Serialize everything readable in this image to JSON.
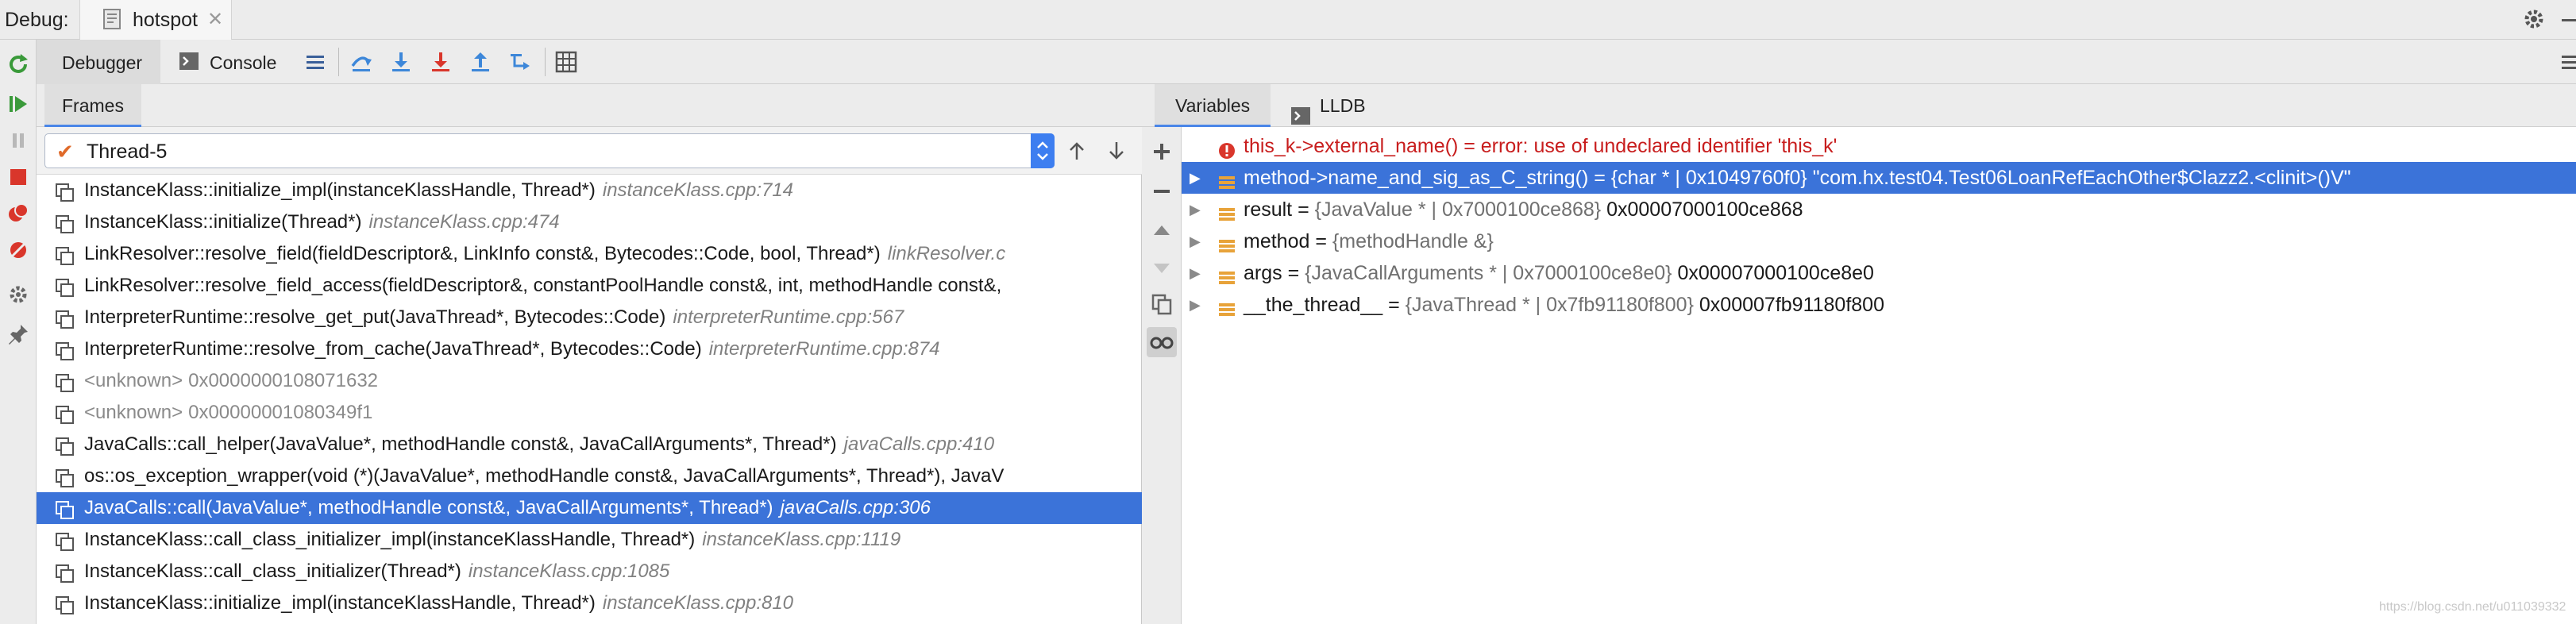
{
  "window": {
    "debug_label": "Debug:",
    "session_tab": "hotspot"
  },
  "toolbar": {
    "tabs": [
      {
        "label": "Debugger",
        "selected": true
      },
      {
        "label": "Console",
        "selected": false
      }
    ]
  },
  "frames": {
    "tab_label": "Frames",
    "thread": "Thread-5",
    "rows": [
      {
        "name": "InstanceKlass::initialize_impl(instanceKlassHandle, Thread*)",
        "loc": "instanceKlass.cpp:714",
        "unknown": false,
        "selected": false
      },
      {
        "name": "InstanceKlass::initialize(Thread*)",
        "loc": "instanceKlass.cpp:474",
        "unknown": false,
        "selected": false
      },
      {
        "name": "LinkResolver::resolve_field(fieldDescriptor&, LinkInfo const&, Bytecodes::Code, bool, Thread*)",
        "loc": "linkResolver.c",
        "unknown": false,
        "selected": false
      },
      {
        "name": "LinkResolver::resolve_field_access(fieldDescriptor&, constantPoolHandle const&, int, methodHandle const&,",
        "loc": "",
        "unknown": false,
        "selected": false
      },
      {
        "name": "InterpreterRuntime::resolve_get_put(JavaThread*, Bytecodes::Code)",
        "loc": "interpreterRuntime.cpp:567",
        "unknown": false,
        "selected": false
      },
      {
        "name": "InterpreterRuntime::resolve_from_cache(JavaThread*, Bytecodes::Code)",
        "loc": "interpreterRuntime.cpp:874",
        "unknown": false,
        "selected": false
      },
      {
        "name": "<unknown>",
        "loc": "0x0000000108071632",
        "unknown": true,
        "selected": false
      },
      {
        "name": "<unknown>",
        "loc": "0x00000001080349f1",
        "unknown": true,
        "selected": false
      },
      {
        "name": "JavaCalls::call_helper(JavaValue*, methodHandle const&, JavaCallArguments*, Thread*)",
        "loc": "javaCalls.cpp:410",
        "unknown": false,
        "selected": false
      },
      {
        "name": "os::os_exception_wrapper(void (*)(JavaValue*, methodHandle const&, JavaCallArguments*, Thread*), JavaV",
        "loc": "",
        "unknown": false,
        "selected": false
      },
      {
        "name": "JavaCalls::call(JavaValue*, methodHandle const&, JavaCallArguments*, Thread*)",
        "loc": "javaCalls.cpp:306",
        "unknown": false,
        "selected": true
      },
      {
        "name": "InstanceKlass::call_class_initializer_impl(instanceKlassHandle, Thread*)",
        "loc": "instanceKlass.cpp:1119",
        "unknown": false,
        "selected": false
      },
      {
        "name": "InstanceKlass::call_class_initializer(Thread*)",
        "loc": "instanceKlass.cpp:1085",
        "unknown": false,
        "selected": false
      },
      {
        "name": "InstanceKlass::initialize_impl(instanceKlassHandle, Thread*)",
        "loc": "instanceKlass.cpp:810",
        "unknown": false,
        "selected": false
      }
    ]
  },
  "variables": {
    "tabs": [
      {
        "label": "Variables",
        "selected": true
      },
      {
        "label": "LLDB",
        "selected": false
      }
    ],
    "rows": [
      {
        "kind": "error",
        "expandable": false,
        "name": "this_k->external_name()",
        "type": "",
        "value": "error: use of undeclared identifier 'this_k'",
        "selected": false
      },
      {
        "kind": "var",
        "expandable": true,
        "name": "method->name_and_sig_as_C_string()",
        "type": "{char * | 0x1049760f0}",
        "value": "\"com.hx.test04.Test06LoanRefEachOther$Clazz2.<clinit>()V\"",
        "selected": true
      },
      {
        "kind": "var",
        "expandable": true,
        "name": "result",
        "type": "{JavaValue * | 0x7000100ce868}",
        "value": "0x00007000100ce868",
        "selected": false
      },
      {
        "kind": "var",
        "expandable": true,
        "name": "method",
        "type": "{methodHandle &}",
        "value": "",
        "selected": false
      },
      {
        "kind": "var",
        "expandable": true,
        "name": "args",
        "type": "{JavaCallArguments * | 0x7000100ce8e0}",
        "value": "0x00007000100ce8e0",
        "selected": false
      },
      {
        "kind": "var",
        "expandable": true,
        "name": "__the_thread__",
        "type": "{JavaThread * | 0x7fb91180f800}",
        "value": "0x00007fb91180f800",
        "selected": false
      }
    ]
  },
  "footer": {
    "watermark": "https://blog.csdn.net/u011039332"
  },
  "colors": {
    "selection": "#3b73d9",
    "error": "#c81d1d",
    "accent_tab": "#4a86e8",
    "frame_location": "#808080"
  }
}
